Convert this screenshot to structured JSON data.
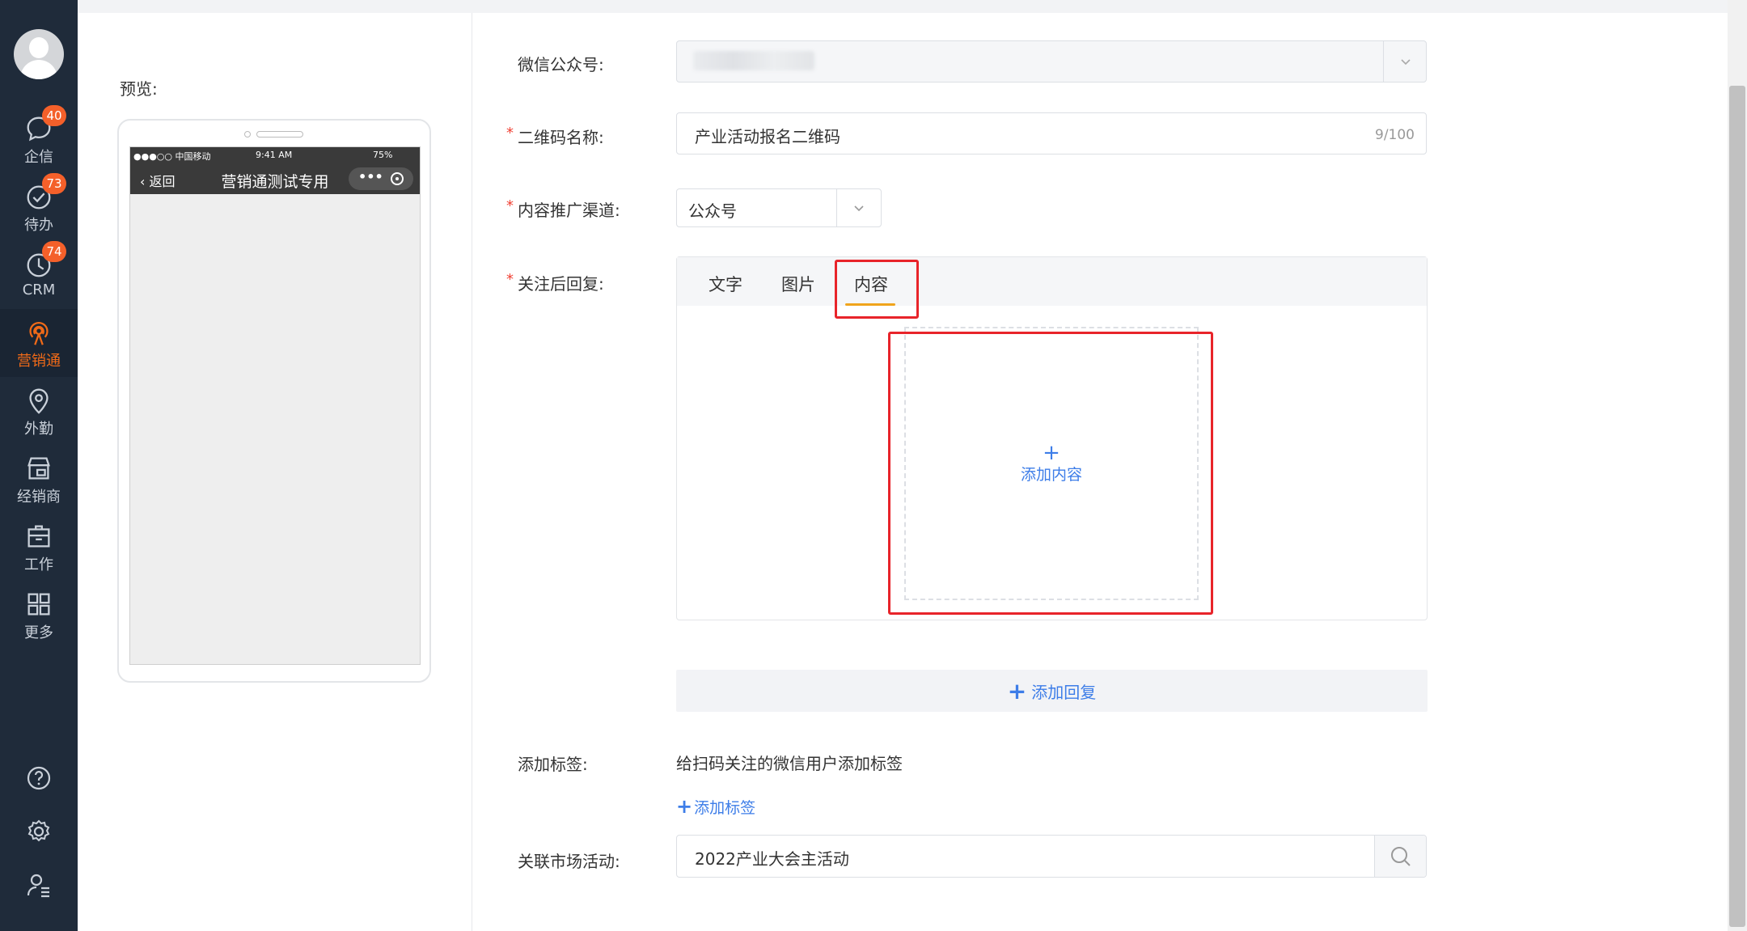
{
  "nav": {
    "items": [
      {
        "label": "企信",
        "icon": "chat-icon",
        "badge": "40"
      },
      {
        "label": "待办",
        "icon": "check-circle-icon",
        "badge": "73"
      },
      {
        "label": "CRM",
        "icon": "clock-icon",
        "badge": "74"
      },
      {
        "label": "营销通",
        "icon": "broadcast-icon",
        "active": true
      },
      {
        "label": "外勤",
        "icon": "location-pin-icon"
      },
      {
        "label": "经销商",
        "icon": "store-icon"
      },
      {
        "label": "工作",
        "icon": "briefcase-icon"
      },
      {
        "label": "更多",
        "icon": "grid-icon"
      }
    ],
    "bottom_icons": [
      "help-icon",
      "settings-icon",
      "user-settings-icon"
    ],
    "colors": {
      "background": "#1f2b3a",
      "active": "#f06a18",
      "badge": "#f4602a"
    }
  },
  "preview": {
    "label": "预览:",
    "status_left": "●●●○○ 中国移动",
    "status_time": "9:41 AM",
    "status_battery": "75%",
    "back_label": "返回",
    "title": "营销通测试专用"
  },
  "form": {
    "wechat_account": {
      "label": "微信公众号:"
    },
    "qr_name": {
      "label": "二维码名称:",
      "value": "产业活动报名二维码",
      "count": "9/100"
    },
    "channel": {
      "label": "内容推广渠道:",
      "value": "公众号"
    },
    "reply": {
      "label": "关注后回复:",
      "tabs": [
        "文字",
        "图片",
        "内容"
      ],
      "active_tab": "内容",
      "add_content": "添加内容",
      "add_reply": "添加回复"
    },
    "tags": {
      "label": "添加标签:",
      "description": "给扫码关注的微信用户添加标签",
      "add_tag": "添加标签"
    },
    "campaign": {
      "label": "关联市场活动:",
      "value": "2022产业大会主活动"
    },
    "required_mark": "*"
  },
  "colors": {
    "link": "#3d7de8",
    "highlight": "#e8242a",
    "tab_underline": "#f0a41c"
  }
}
